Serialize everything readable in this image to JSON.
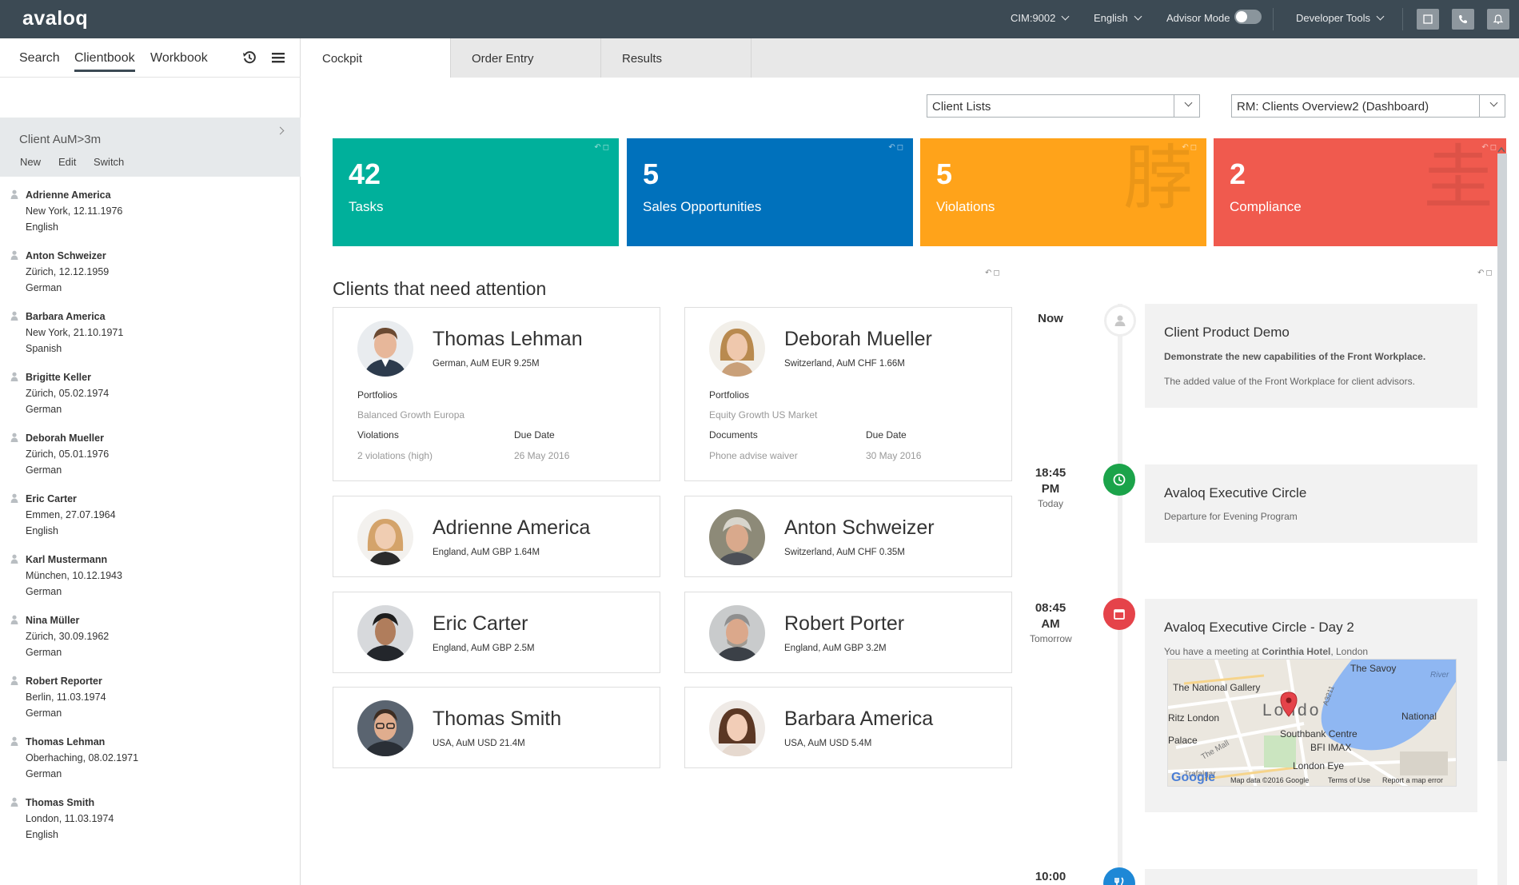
{
  "topbar": {
    "logo": "avaloq",
    "instance": "CIM:9002",
    "language": "English",
    "advisor_mode_label": "Advisor Mode",
    "advisor_mode_on": false,
    "developer_tools": "Developer Tools"
  },
  "sidebar": {
    "tabs": [
      "Search",
      "Clientbook",
      "Workbook"
    ],
    "active_tab": "Clientbook",
    "list_title": "Client AuM>3m",
    "actions": [
      "New",
      "Edit",
      "Switch"
    ],
    "clients": [
      {
        "name": "Adrienne America",
        "line1": "New York, 12.11.1976",
        "line2": "English"
      },
      {
        "name": "Anton Schweizer",
        "line1": "Zürich, 12.12.1959",
        "line2": "German"
      },
      {
        "name": "Barbara America",
        "line1": "New York, 21.10.1971",
        "line2": "Spanish"
      },
      {
        "name": "Brigitte Keller",
        "line1": "Zürich, 05.02.1974",
        "line2": "German"
      },
      {
        "name": "Deborah Mueller",
        "line1": "Zürich, 05.01.1976",
        "line2": "German"
      },
      {
        "name": "Eric Carter",
        "line1": "Emmen, 27.07.1964",
        "line2": "English"
      },
      {
        "name": "Karl Mustermann",
        "line1": "München, 10.12.1943",
        "line2": "German"
      },
      {
        "name": "Nina Müller",
        "line1": "Zürich, 30.09.1962",
        "line2": "German"
      },
      {
        "name": "Robert Reporter",
        "line1": "Berlin, 11.03.1974",
        "line2": "German"
      },
      {
        "name": "Thomas Lehman",
        "line1": "Oberhaching, 08.02.1971",
        "line2": "German"
      },
      {
        "name": "Thomas Smith",
        "line1": "London, 11.03.1974",
        "line2": "English"
      }
    ]
  },
  "main": {
    "tabs": [
      "Cockpit",
      "Order Entry",
      "Results"
    ],
    "active_tab": "Cockpit",
    "client_lists_select": "Client Lists",
    "dashboard_select": "RM: Clients Overview2 (Dashboard)",
    "tiles": [
      {
        "value": "42",
        "label": "Tasks",
        "color": "#00b09b"
      },
      {
        "value": "5",
        "label": "Sales Opportunities",
        "color": "#0071bc"
      },
      {
        "value": "5",
        "label": "Violations",
        "color": "#ffa31a"
      },
      {
        "value": "2",
        "label": "Compliance",
        "color": "#f05a4e"
      }
    ],
    "attention_title": "Clients that need attention",
    "attention_clients": [
      {
        "name": "Thomas Lehman",
        "info": "German, AuM EUR 9.25M",
        "f1_label": "Portfolios",
        "f1_value": "Balanced Growth Europa",
        "f2_label": "Violations",
        "f2_value": "2 violations (high)",
        "f3_label": "Due Date",
        "f3_value": "26 May 2016"
      },
      {
        "name": "Deborah Mueller",
        "info": "Switzerland, AuM CHF 1.66M",
        "f1_label": "Portfolios",
        "f1_value": "Equity Growth US Market",
        "f2_label": "Documents",
        "f2_value": "Phone advise waiver",
        "f3_label": "Due Date",
        "f3_value": "30 May 2016"
      },
      {
        "name": "Adrienne America",
        "info": "England, AuM GBP 1.64M"
      },
      {
        "name": "Anton Schweizer",
        "info": "Switzerland, AuM CHF 0.35M"
      },
      {
        "name": "Eric Carter",
        "info": "England, AuM GBP 2.5M"
      },
      {
        "name": "Robert Porter",
        "info": "England, AuM GBP 3.2M"
      },
      {
        "name": "Thomas Smith",
        "info": "USA, AuM USD 21.4M"
      },
      {
        "name": "Barbara America",
        "info": "USA, AuM USD 5.4M"
      }
    ],
    "timeline": [
      {
        "time": "Now",
        "sub": "",
        "title": "Client Product Demo",
        "bold_line": "Demonstrate the new capabilities of the Front Workplace.",
        "line": "The added value of the Front Workplace for client advisors.",
        "icon": "person-icon",
        "color": "#ffffff"
      },
      {
        "time": "18:45 PM",
        "sub": "Today",
        "title": "Avaloq Executive Circle",
        "line": "Departure for Evening Program",
        "icon": "clock-icon",
        "color": "#1ba34a"
      },
      {
        "time": "08:45 AM",
        "sub": "Tomorrow",
        "title": "Avaloq Executive Circle - Day 2",
        "line_prefix": "You have a meeting at ",
        "line_bold": "Corinthia Hotel",
        "line_suffix": ", London",
        "icon": "calendar-icon",
        "color": "#e5434a"
      },
      {
        "time": "10:00",
        "sub": "",
        "icon": "cutlery-icon",
        "color": "#1e88d6"
      }
    ],
    "map": {
      "labels": [
        "The Savoy",
        "The National Gallery",
        "Ritz London",
        "Londo",
        "National",
        "Southbank Centre",
        "BFI IMAX",
        "Palace",
        "The Mall",
        "Trafalgar",
        "London Eye",
        "River",
        "A3211"
      ],
      "footer": [
        "Map data ©2016 Google",
        "Terms of Use",
        "Report a map error"
      ],
      "brand": "Google"
    }
  }
}
